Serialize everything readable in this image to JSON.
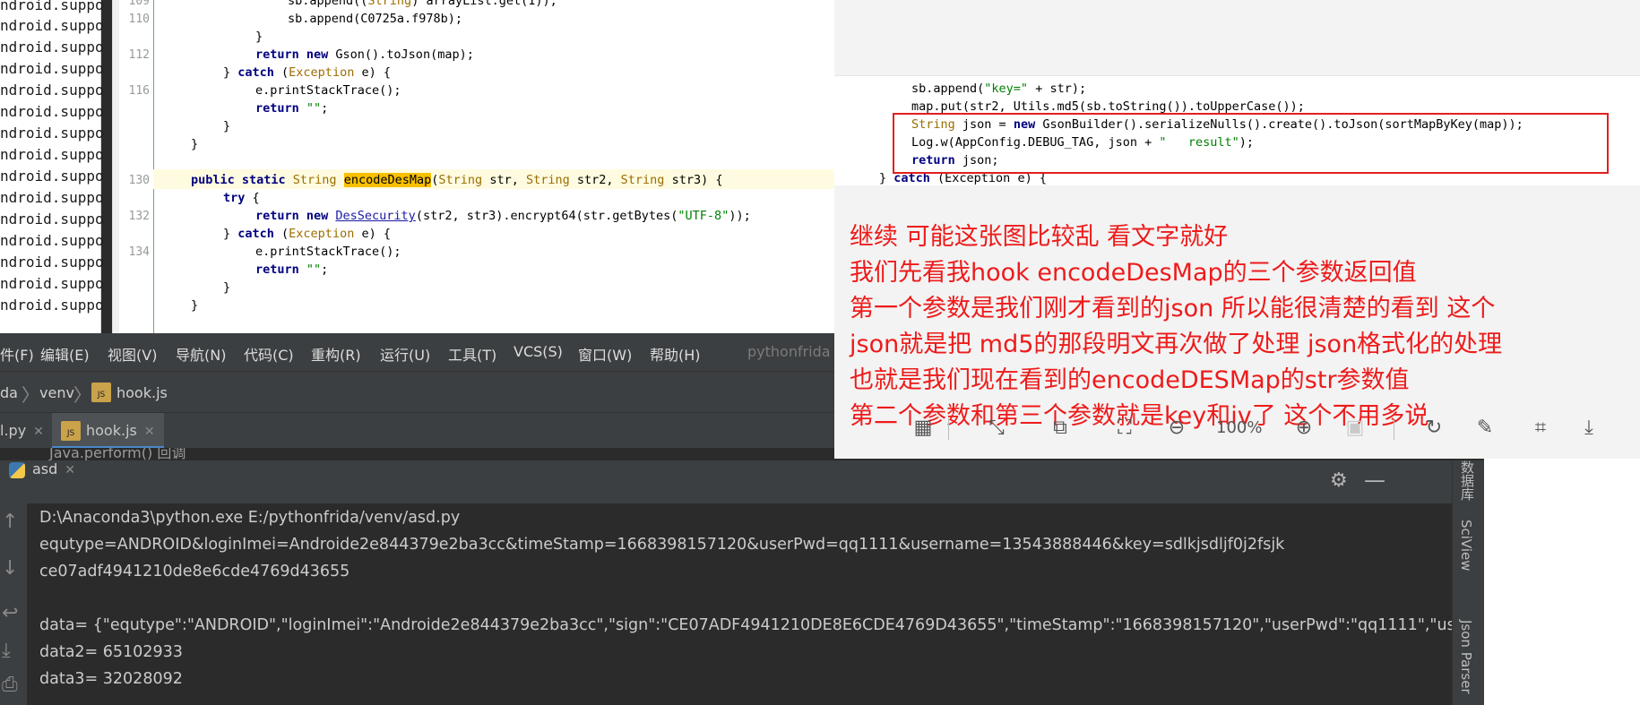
{
  "left_gutter": {
    "lines": [
      "ndroid.suppo",
      "ndroid.suppo",
      "ndroid.suppo",
      "ndroid.suppo",
      "ndroid.suppo",
      "ndroid.suppo",
      "ndroid.suppo",
      "ndroid.suppo",
      "ndroid.suppo",
      "ndroid.suppo",
      "ndroid.suppo",
      "ndroid.suppo",
      "ndroid.suppo",
      "ndroid.suppo",
      "ndroid.suppo"
    ]
  },
  "editor_left": {
    "line_numbers": [
      "109",
      "110",
      "112",
      "116",
      "130",
      "132",
      "134"
    ],
    "code": {
      "l1a": "sb.append((",
      "l1b": "String",
      "l1c": ") arrayList.get(1));",
      "l2": "sb.append(C0725a.f978b);",
      "l3": "}",
      "l4a": "return new ",
      "l4b": "Gson().toJson(map);",
      "l5a": "} ",
      "l5b": "catch",
      "l5c": " (",
      "l5d": "Exception",
      "l5e": " e) {",
      "l6": "e.printStackTrace();",
      "l7a": "return ",
      "l7b": "\"\"",
      "l7c": ";",
      "l8": "}",
      "l9": "}",
      "l10a": "public static ",
      "l10b": "String",
      "l10c": " ",
      "l10d": "encodeDesMap",
      "l10e": "(",
      "l10f": "String",
      "l10g": " str, ",
      "l10h": "String",
      "l10i": " str2, ",
      "l10j": "String",
      "l10k": " str3) {",
      "l11a": "try",
      "l11b": " {",
      "l12a": "return new ",
      "l12b": "DesSecurity",
      "l12c": "(str2, str3).encrypt64(str.getBytes(",
      "l12d": "\"UTF-8\"",
      "l12e": "));",
      "l13a": "} ",
      "l13b": "catch",
      "l13c": " (",
      "l13d": "Exception",
      "l13e": " e) {",
      "l14": "e.printStackTrace();",
      "l15a": "return ",
      "l15b": "\"\"",
      "l15c": ";",
      "l16": "}",
      "l17": "}"
    }
  },
  "code_right": {
    "r1a": "sb.append(",
    "r1b": "\"key=\"",
    "r1c": " + str);",
    "r2": "map.put(str2, Utils.md5(sb.toString()).toUpperCase());",
    "r3a": "String",
    "r3b": " json = ",
    "r3c": "new ",
    "r3d": "GsonBuilder().serializeNulls().create().toJson(sortMapByKey(map));",
    "r4a": "Log.w(AppConfig.DEBUG_TAG, json + ",
    "r4b": "\"   result\"",
    "r4c": ");",
    "r5a": "return ",
    "r5b": "json;",
    "r6a": "} ",
    "r6b": "catch",
    "r6c": " (Exception e) {"
  },
  "notes": [
    "继续  可能这张图比较乱  看文字就好",
    "我们先看我hook  encodeDesMap的三个参数返回值",
    "第一个参数是我们刚才看到的json  所以能很清楚的看到  这个",
    "json就是把 md5的那段明文再次做了处理 json格式化的处理",
    "也就是我们现在看到的encodeDESMap的str参数值",
    "第二个参数和第三个参数就是key和iv了  这个不用多说"
  ],
  "viewer_toolbar": {
    "zoom": "100%",
    "icons": [
      "grid-icon",
      "fit-screen-icon",
      "original-size-icon",
      "fullscreen-icon",
      "zoom-out-icon",
      "zoom-in-icon",
      "ocr-icon",
      "rotate-icon",
      "edit-icon",
      "crop-icon",
      "download-icon"
    ]
  },
  "menubar": {
    "items": [
      "件(F)",
      "编辑(E)",
      "视图(V)",
      "导航(N)",
      "代码(C)",
      "重构(R)",
      "运行(U)",
      "工具(T)",
      "VCS(S)",
      "窗口(W)",
      "帮助(H)"
    ],
    "project": "pythonfrida"
  },
  "breadcrumb": {
    "items": [
      "da",
      "venv",
      "hook.js"
    ]
  },
  "tabs": [
    {
      "label": "l.py"
    },
    {
      "label": "hook.js"
    }
  ],
  "strip_text": "Java.perform() 回调",
  "run": {
    "tab_label": "asd",
    "console_lines": [
      "D:\\Anaconda3\\python.exe E:/pythonfrida/venv/asd.py",
      "equtype=ANDROID&loginImei=Androide2e844379e2ba3cc&timeStamp=1668398157120&userPwd=qq1111&username=13543888446&key=sdlkjsdljf0j2fsjk",
      "ce07adf4941210de8e6cde4769d43655",
      "",
      "data= {\"equtype\":\"ANDROID\",\"loginImei\":\"Androide2e844379e2ba3cc\",\"sign\":\"CE07ADF4941210DE8E6CDE4769D43655\",\"timeStamp\":\"1668398157120\",\"userPwd\":\"qq1111\",\"usern",
      "data2= 65102933",
      "data3= 32028092"
    ]
  },
  "right_tool_stripe": [
    "数据库",
    "SciView",
    "Json Parser"
  ]
}
